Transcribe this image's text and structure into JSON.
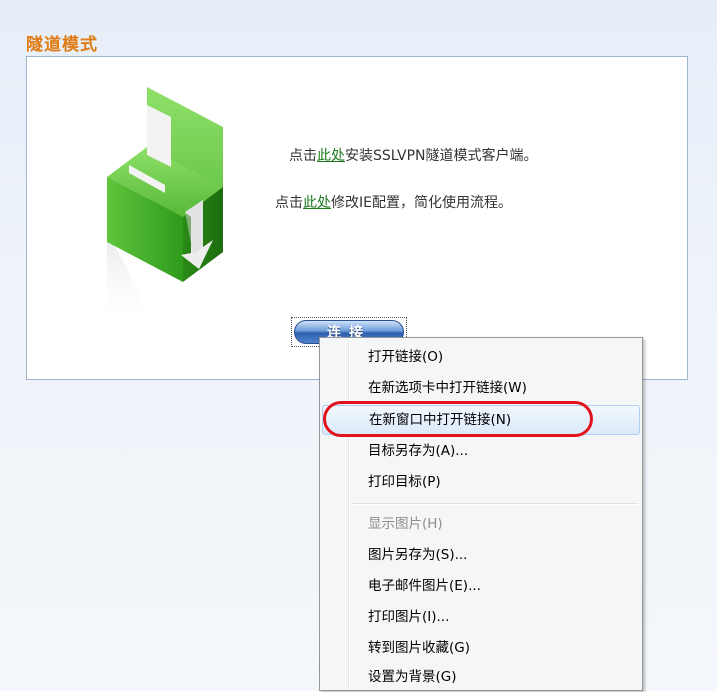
{
  "section": {
    "title": "隧道模式"
  },
  "info": {
    "line1_prefix": "点击",
    "line1_link": "此处",
    "line1_suffix": "安装SSLVPN隧道模式客户端。",
    "line2_prefix": "点击",
    "line2_link": "此处",
    "line2_suffix": "修改IE配置，简化使用流程。"
  },
  "connect_button": {
    "label": "连接"
  },
  "context_menu": {
    "items": [
      {
        "label": "打开链接(O)"
      },
      {
        "label": "在新选项卡中打开链接(W)"
      },
      {
        "label": "在新窗口中打开链接(N)"
      },
      {
        "label": "目标另存为(A)..."
      },
      {
        "label": "打印目标(P)"
      },
      {
        "label": "显示图片(H)"
      },
      {
        "label": "图片另存为(S)..."
      },
      {
        "label": "电子邮件图片(E)..."
      },
      {
        "label": "打印图片(I)..."
      },
      {
        "label": "转到图片收藏(G)"
      },
      {
        "label": "设置为背景(G)"
      }
    ]
  },
  "colors": {
    "title": "#e07b12",
    "link": "#1c7a1c",
    "highlight_ring": "#e2131c",
    "button_blue": "#2d5fae"
  },
  "icons": {
    "package": "install-package-icon"
  }
}
